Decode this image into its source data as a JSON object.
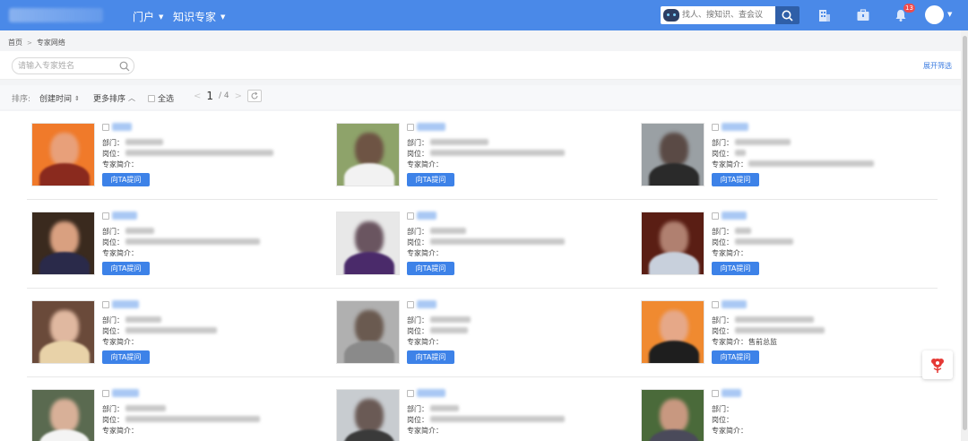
{
  "header": {
    "nav": [
      {
        "label": "门户"
      },
      {
        "label": "知识专家"
      }
    ],
    "search": {
      "placeholder": "找人、搜知识、查会议"
    },
    "notifications": {
      "count": "13"
    },
    "colors": {
      "bar": "#4a89e8",
      "search_button": "#2f5fa8",
      "badge": "#f04b4b"
    }
  },
  "breadcrumb": {
    "home": "首页",
    "current": "专家网络"
  },
  "filter": {
    "name_placeholder": "请输入专家姓名",
    "expand_label": "展开筛选"
  },
  "toolbar": {
    "sort_label": "排序:",
    "sort_by": "创建时间",
    "more_sort": "更多排序",
    "select_all": "全选",
    "pager": {
      "current": "1",
      "total": "/ 4"
    }
  },
  "experts": {
    "dept_label": "部门：",
    "position_label": "岗位：",
    "intro_label": "专家简介：",
    "ask_button": "向TA提问",
    "visible_intro": "售前总监"
  },
  "icons": {
    "robot": "robot-icon",
    "search": "search-icon",
    "building": "building-icon",
    "briefcase": "briefcase-icon",
    "bell": "bell-icon",
    "refresh": "refresh-icon",
    "widget": "flower-widget-icon"
  },
  "accent_color": "#3d82e8"
}
